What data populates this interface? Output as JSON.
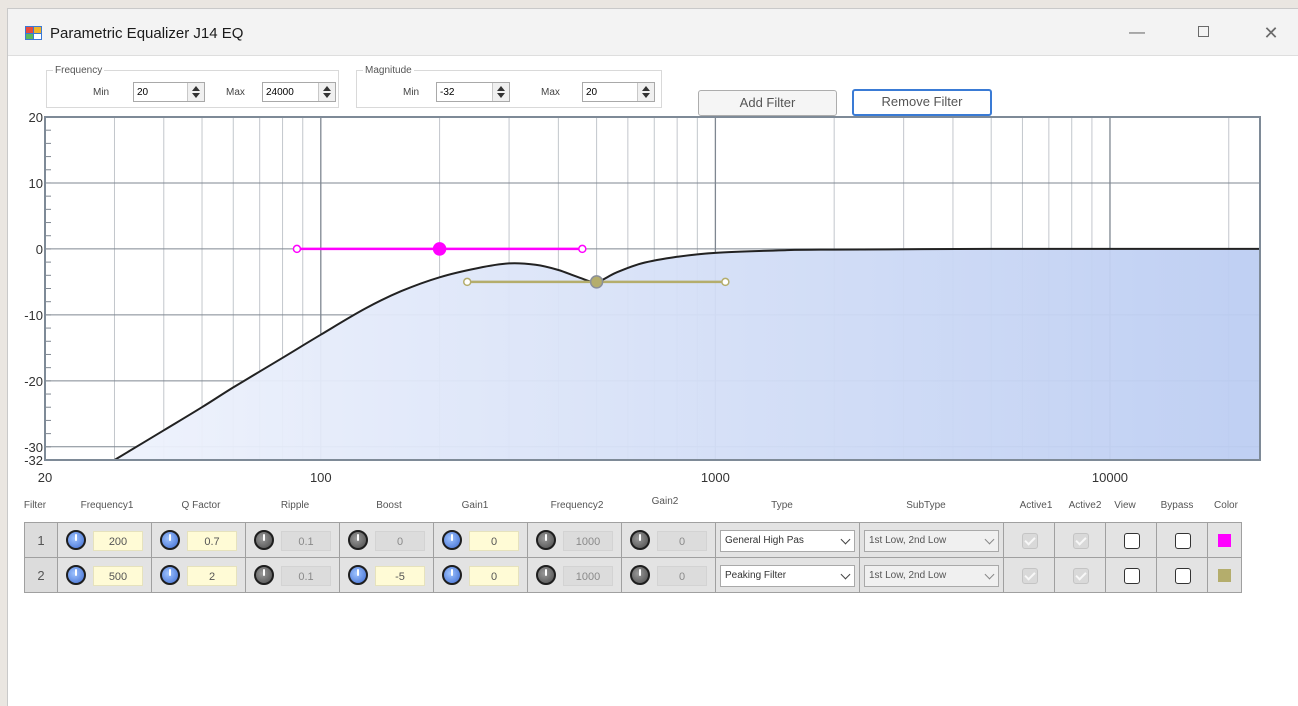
{
  "window": {
    "title": "Parametric Equalizer J14 EQ",
    "controls": {
      "minimize": "—",
      "close": "✕"
    }
  },
  "frequency_group": {
    "legend": "Frequency",
    "min_label": "Min",
    "min_value": "20",
    "max_label": "Max",
    "max_value": "24000"
  },
  "magnitude_group": {
    "legend": "Magnitude",
    "min_label": "Min",
    "min_value": "-32",
    "max_label": "Max",
    "max_value": "20"
  },
  "buttons": {
    "add_filter": "Add Filter",
    "remove_filter": "Remove Filter"
  },
  "chart_data": {
    "type": "line",
    "title": "",
    "x_scale": "log",
    "xlim": [
      20,
      24000
    ],
    "ylim": [
      -32,
      20
    ],
    "x_tick_labels": [
      "20",
      "100",
      "1000",
      "10000"
    ],
    "y_tick_labels": [
      "20",
      "10",
      "0",
      "-10",
      "-20",
      "-30",
      "-32"
    ],
    "grid": true,
    "series": [
      {
        "kind": "response-curve",
        "x": [
          30,
          40,
          50,
          60,
          80,
          100,
          130,
          160,
          200,
          250,
          300,
          350,
          400,
          450,
          500,
          560,
          650,
          800,
          1000,
          1500,
          2000,
          5000,
          10000,
          24000
        ],
        "y": [
          -32,
          -27.5,
          -24,
          -21,
          -16.5,
          -13,
          -9,
          -6.4,
          -4.3,
          -2.9,
          -2.2,
          -2.4,
          -3.2,
          -4.3,
          -5,
          -3.6,
          -2.2,
          -1.2,
          -0.6,
          -0.2,
          -0.1,
          0,
          0,
          0
        ]
      },
      {
        "kind": "filter-handle",
        "filter": 1,
        "color": "#ff00ff",
        "center": {
          "freq": 200,
          "gain": 0
        },
        "bandwidth": {
          "low": 87,
          "high": 460,
          "gain": 0
        }
      },
      {
        "kind": "filter-handle",
        "filter": 2,
        "color": "#b4ad6c",
        "center": {
          "freq": 500,
          "gain": -5
        },
        "bandwidth": {
          "low": 235,
          "high": 1060,
          "gain": -5
        }
      }
    ],
    "fill_color": "#c7d5f5",
    "curve_color": "#222222"
  },
  "table": {
    "headers": [
      "Filter",
      "Frequency1",
      "Q Factor",
      "Ripple",
      "Boost",
      "Gain1",
      "Frequency2",
      "Gain2",
      "Type",
      "SubType",
      "Active1",
      "Active2",
      "View",
      "Bypass",
      "Color"
    ],
    "rows": [
      {
        "filter": "1",
        "frequency1": "200",
        "q_factor": "0.7",
        "ripple": "0.1",
        "boost": "0",
        "gain1": "0",
        "frequency2": "1000",
        "gain2": "0",
        "type": "General High Pas",
        "subtype": "1st Low, 2nd Low",
        "color": "#ff00ff"
      },
      {
        "filter": "2",
        "frequency1": "500",
        "q_factor": "2",
        "ripple": "0.1",
        "boost": "-5",
        "gain1": "0",
        "frequency2": "1000",
        "gain2": "0",
        "type": "Peaking Filter",
        "subtype": "1st Low, 2nd Low",
        "color": "#b4ad6c"
      }
    ]
  }
}
